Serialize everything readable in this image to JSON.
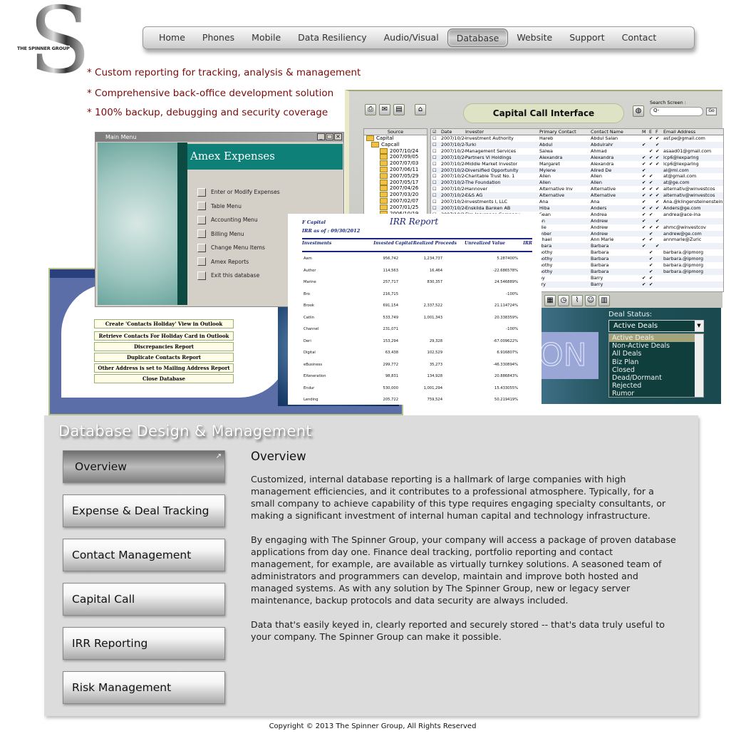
{
  "logo": {
    "letter": "S",
    "text": "THE SPINNER GROUP"
  },
  "nav": {
    "items": [
      "Home",
      "Phones",
      "Mobile",
      "Data Resiliency",
      "Audio/Visual",
      "Database",
      "Website",
      "Support",
      "Contact"
    ],
    "active": "Database"
  },
  "bullets": [
    "* Custom reporting for tracking, analysis & management",
    "* Comprehensive back-office development solution",
    "* 100% backup, debugging and security coverage"
  ],
  "capital_call": {
    "title": "Capital Call Interface",
    "search_label": "Search Screen :",
    "search_placeholder": "Q-",
    "go": "Go",
    "source_header": "Source",
    "tree": [
      "Capital",
      "Capcall",
      "2007/10/24",
      "2007/09/05",
      "2007/07/03",
      "2007/06/11",
      "2007/05/29",
      "2007/05/17",
      "2007/04/26",
      "2007/03/20",
      "2007/02/07",
      "2007/01/25",
      "2006/10/19"
    ],
    "columns": [
      "Date",
      "Investor",
      "Primary Contact",
      "Contact Name",
      "M",
      "E",
      "F",
      "Email Address"
    ],
    "rows": [
      [
        "2007/10/24",
        "Investment Authority",
        "Hareb",
        "Abdul Salan",
        "011",
        "asf.pe@gmail.com"
      ],
      [
        "2007/10/24",
        "Turki",
        "Abdul",
        "Abdulrahr",
        "101",
        ""
      ],
      [
        "2007/10/24",
        "Management Services",
        "Salwa",
        "Ahmad",
        "011",
        "asaad01@gmail.com"
      ],
      [
        "2007/10/24",
        "Partners VI Holdings",
        "Alexandra",
        "Alexandra",
        "111",
        "lcp6@lexparlng"
      ],
      [
        "2007/10/24",
        "Middle Market Investor",
        "Margaret",
        "Alexandra",
        "111",
        "lcp6@lexparlng"
      ],
      [
        "2007/10/24",
        "Diversified Opportunity",
        "Mylene",
        "Allred De",
        "100",
        "al@ml.com"
      ],
      [
        "2007/10/24",
        "Charitable Trust No. 1",
        "Allen",
        "Allen",
        "110",
        "at@gmail.com"
      ],
      [
        "2007/10/24",
        "The Foundation",
        "Allen",
        "Allen",
        "110",
        "at@ge.com"
      ],
      [
        "2007/10/24",
        "Hannover",
        "Alternative Inv",
        "Alternative",
        "111",
        "alternativ@winvestcos"
      ],
      [
        "2007/10/24",
        "E&S AG",
        "Alternative",
        "Alternative",
        "111",
        "alternativ@winvestcos"
      ],
      [
        "2007/10/24",
        "Investments I, LLC",
        "Ana",
        "Ana",
        "101",
        "Ana.@klingensteinenstein."
      ],
      [
        "2007/10/24",
        "Enskilda Banken AB",
        "Hiba",
        "Anders",
        "111",
        "Anders@ge.com"
      ],
      [
        "2007/10/24",
        "Fire Insurance Company",
        "Sean",
        "Andrea",
        "110",
        "andrea@ace-ina"
      ],
      [
        "",
        "",
        "an",
        "Andrew",
        "101",
        ""
      ],
      [
        "",
        "",
        "die",
        "Andrew",
        "111",
        "ahmc@winvestcov"
      ],
      [
        "",
        "",
        "mber",
        "Andrew",
        "010",
        "andrew@ge.com"
      ],
      [
        "",
        "",
        "chael",
        "Ann Marie",
        "110",
        "annmarie@Zuric"
      ],
      [
        "",
        "",
        "rbara",
        "Barbara",
        "101",
        ""
      ],
      [
        "",
        "",
        "nothy",
        "Barbara",
        "010",
        "barbara.@ipmorg"
      ],
      [
        "",
        "",
        "nothy",
        "Barbara",
        "010",
        "barbara.@ipmorg"
      ],
      [
        "",
        "",
        "nothy",
        "Barbara",
        "010",
        "barbara.@ipmorg"
      ],
      [
        "",
        "",
        "nothy",
        "Barbara",
        "010",
        "barbara.@ipmorg"
      ],
      [
        "",
        "",
        "ny",
        "Barry",
        "110",
        ""
      ],
      [
        "",
        "",
        "rry",
        "Barry",
        "110",
        ""
      ]
    ]
  },
  "deal_status": {
    "label": "Deal Status:",
    "selected": "Active Deals",
    "options": [
      "Active Deals",
      "Non-Active Deals",
      "All Deals",
      "Biz Plan",
      "Closed",
      "Dead/Dormant",
      "Rejected",
      "Rumor"
    ],
    "background_text": "ON"
  },
  "main_menu": {
    "window_title": "Main Menu",
    "header": "Amex Expenses",
    "items": [
      "Enter or Modify Expenses",
      "Table Menu",
      "Accounting Menu",
      "Billing Menu",
      "Change Menu Items",
      "Amex Reports",
      "Exit this database"
    ]
  },
  "contacts_menu": {
    "buttons": [
      "Create 'Contacts Holiday' View in Outlook",
      "Retrieve Contacts For Holiday Card in Outlook",
      "Discrepancies Report",
      "Duplicate Contacts Report",
      "Other Address is set to Mailing Address Report",
      "Close Database"
    ]
  },
  "irr_report": {
    "title": "IRR Report",
    "company": "F Capital",
    "as_of": "IRR as of :  09/30/2012",
    "columns": [
      "Investments",
      "Invested Capital",
      "Realized Proceeds",
      "Unrealized Value",
      "IRR"
    ],
    "rows": [
      [
        "Aam",
        "956,742",
        "1,234,737",
        "",
        "5.287400%"
      ],
      [
        "Author",
        "114,563",
        "16,464",
        "",
        "-22.686578%"
      ],
      [
        "Marine",
        "257,717",
        "830,357",
        "",
        "24.546889%"
      ],
      [
        "Bro",
        "216,715",
        "",
        "",
        "-100%"
      ],
      [
        "Brook",
        "691,154",
        "2,337,522",
        "",
        "21.114724%"
      ],
      [
        "Catlin",
        "533,749",
        "1,001,343",
        "",
        "20.338359%"
      ],
      [
        "Channel",
        "231,071",
        "",
        "",
        "-100%"
      ],
      [
        "Deri",
        "153,294",
        "29,328",
        "",
        "-67.009622%"
      ],
      [
        "Digital",
        "63,438",
        "102,529",
        "",
        "6.916807%"
      ],
      [
        "eBusiness",
        "299,772",
        "35,273",
        "",
        "-46.330894%"
      ],
      [
        "EXeneration",
        "98,831",
        "134,928",
        "",
        "20.886843%"
      ],
      [
        "Endur",
        "530,000",
        "1,001,294",
        "",
        "15.433055%"
      ],
      [
        "Lending",
        "205,722",
        "759,524",
        "",
        "50.219419%"
      ]
    ]
  },
  "section": {
    "title": "Database Design & Management",
    "menu": [
      "Overview",
      "Expense & Deal Tracking",
      "Contact Management",
      "Capital Call",
      "IRR Reporting",
      "Risk Management"
    ],
    "active": "Overview",
    "content_title": "Overview",
    "paragraphs": [
      "Customized, internal database reporting is a hallmark of large companies with high management efficiencies, and it contributes to a professional atmosphere. Typically, for a small company to achieve capability of this type requires engaging specialty consultants, or making a significant investment of internal human capital and technology infrastructure.",
      "By engaging with The Spinner Group, your company will access a package of proven database applications from day one. Finance deal tracking, portfolio reporting and contact management, for example, are available as virtually turnkey solutions. A seasoned team of administrators and programmers can develop, maintain and improve both hosted and managed systems. As with any solution by The Spinner Group, new or legacy server maintenance, backup protocols and data security are always included.",
      "Data that's easily keyed in, clearly reported and securely stored -- that's data truly useful to your company. The Spinner Group can make it possible."
    ]
  },
  "footer": {
    "copyright": "Copyright © 2013 The Spinner Group, All Rights Reserved"
  },
  "colors": {
    "bullet_text": "#7a0a0a",
    "panel_bg": "#dcdcdc",
    "teal": "#0e8077",
    "irr_blue": "#1a237e"
  }
}
